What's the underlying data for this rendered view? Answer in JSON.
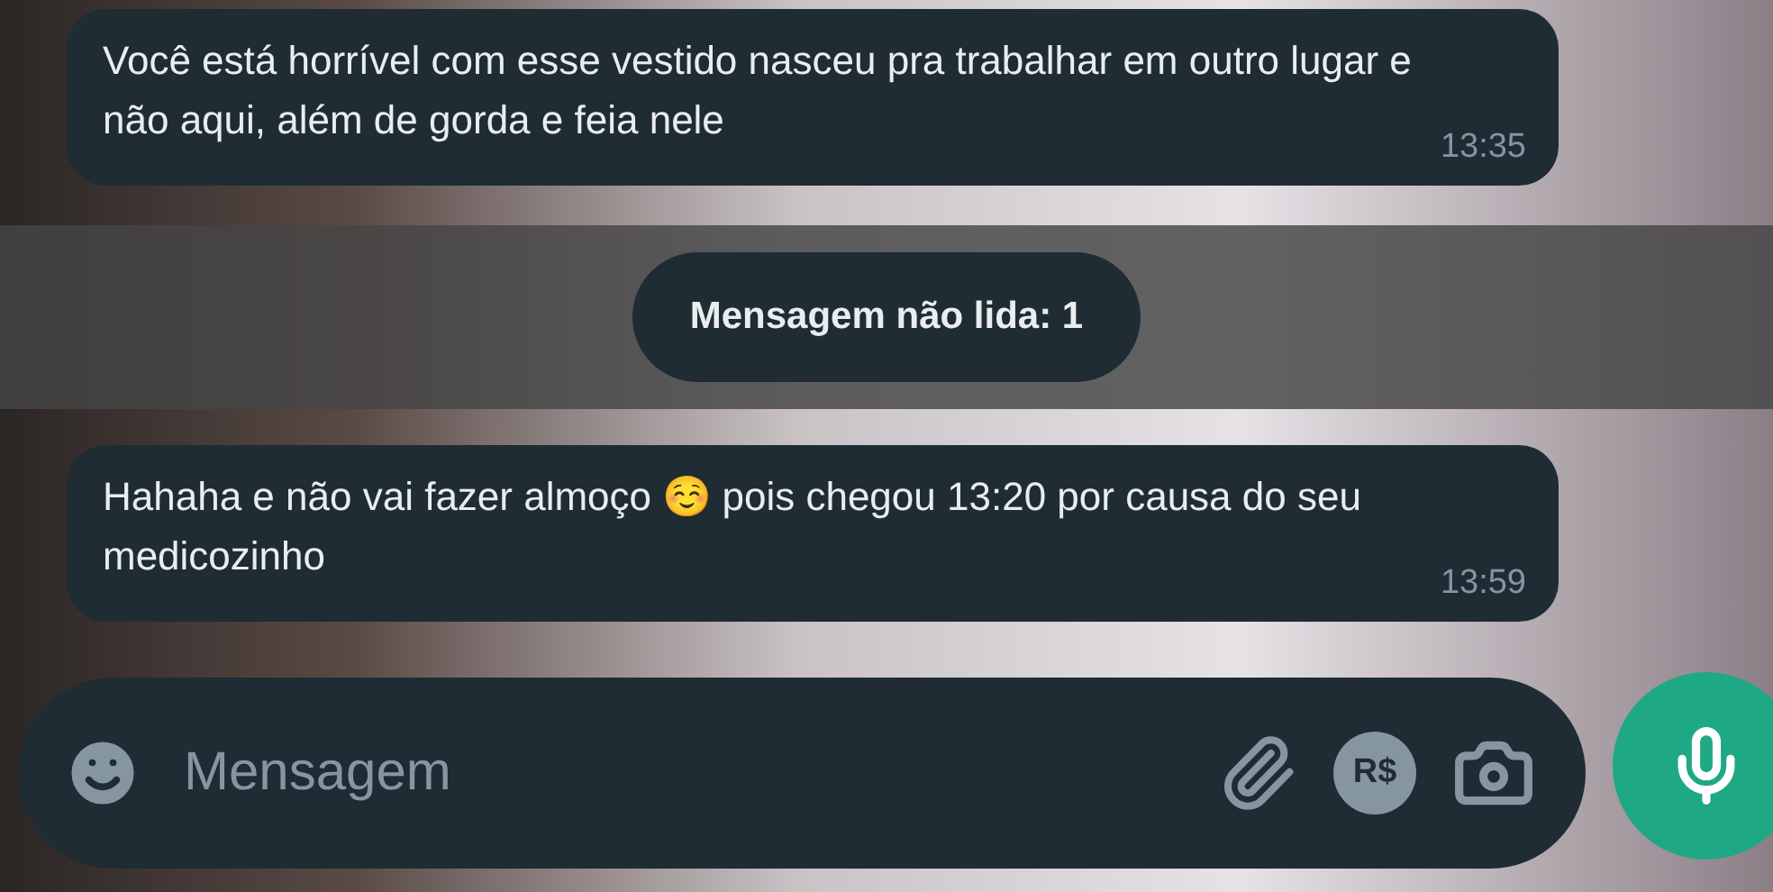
{
  "messages": [
    {
      "text": "Você está horrível com esse vestido nasceu pra trabalhar em outro lugar e não aqui, além de gorda e feia nele",
      "time": "13:35"
    },
    {
      "kind": "unread",
      "text": "Mensagem não lida: 1"
    },
    {
      "text": "Hahaha e não vai fazer almoço ☺️ pois chegou 13:20 por causa do seu medicozinho",
      "time": "13:59"
    }
  ],
  "composer": {
    "placeholder": "Mensagem",
    "payment_label": "R$"
  }
}
